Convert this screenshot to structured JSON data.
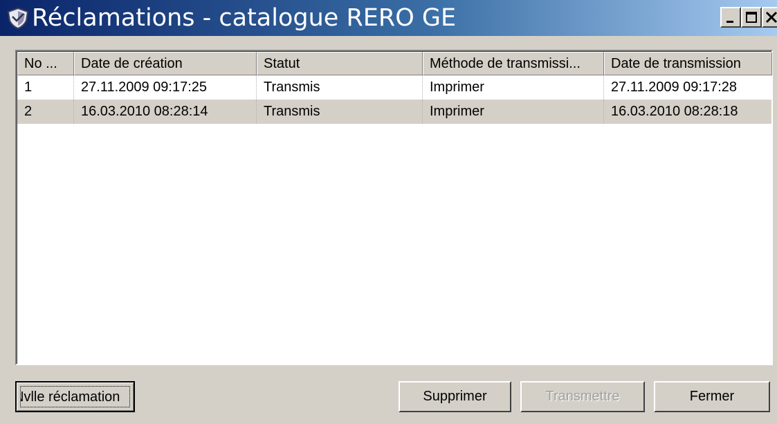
{
  "window": {
    "title": "Réclamations - catalogue RERO GE"
  },
  "table": {
    "columns": [
      "No ...",
      "Date de création",
      "Statut",
      "Méthode de transmissi...",
      "Date de transmission"
    ],
    "rows": [
      [
        "1",
        "27.11.2009 09:17:25",
        "Transmis",
        "Imprimer",
        "27.11.2009 09:17:28"
      ],
      [
        "2",
        "16.03.2010 08:28:14",
        "Transmis",
        "Imprimer",
        "16.03.2010 08:28:18"
      ]
    ],
    "selected_row": 2
  },
  "buttons": {
    "new_claim": "Nvlle réclamation",
    "delete": "Supprimer",
    "transmit": "Transmettre",
    "close": "Fermer"
  },
  "icons": {
    "app": "shield-icon",
    "minimize": "minimize-icon",
    "maximize": "maximize-icon",
    "close": "close-icon"
  },
  "colors": {
    "titlebar_start": "#0a246a",
    "titlebar_end": "#a6caf0",
    "face": "#d4d0c8",
    "disabled_text": "#a0a0a0"
  }
}
